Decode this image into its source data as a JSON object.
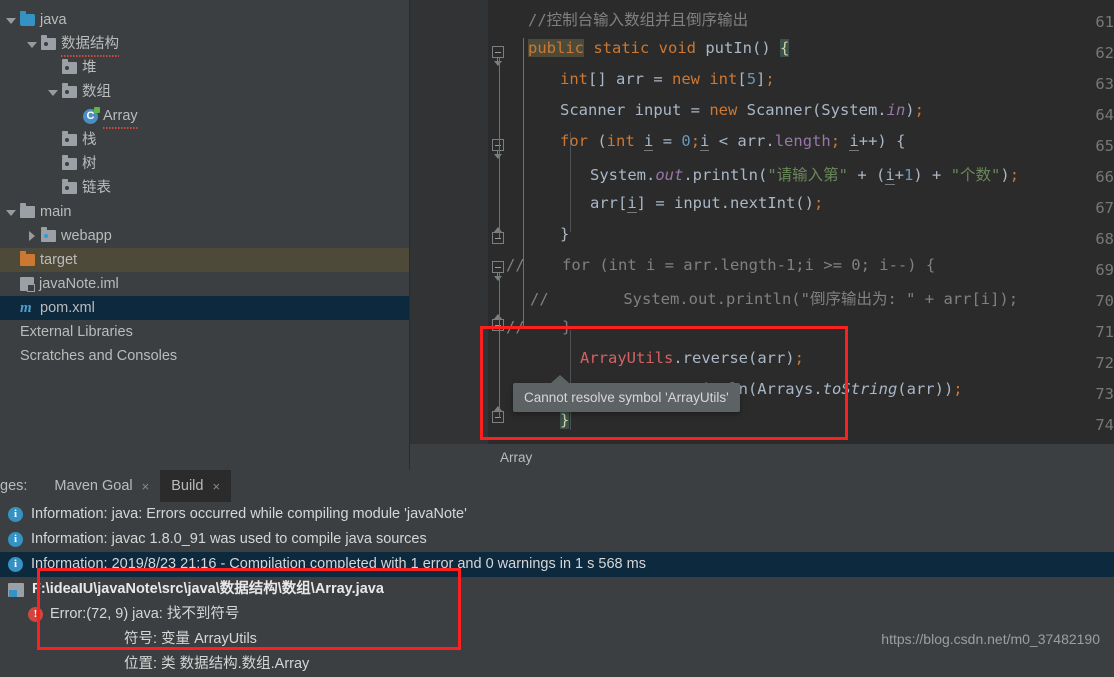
{
  "sidebar": {
    "items": [
      {
        "label": "java",
        "icon": "folder-source-icon",
        "arrow": "down",
        "indent": 0,
        "state": "normal",
        "squiggle": false
      },
      {
        "label": "数据结构",
        "icon": "folder-package-icon",
        "arrow": "down",
        "indent": 1,
        "state": "normal",
        "squiggle": true
      },
      {
        "label": "堆",
        "icon": "folder-package-icon",
        "arrow": "none",
        "indent": 2,
        "state": "normal",
        "squiggle": false
      },
      {
        "label": "数组",
        "icon": "folder-package-icon",
        "arrow": "down",
        "indent": 2,
        "state": "normal",
        "squiggle": false
      },
      {
        "label": "Array",
        "icon": "java-class-icon",
        "arrow": "none",
        "indent": 3,
        "state": "normal",
        "squiggle": true
      },
      {
        "label": "栈",
        "icon": "folder-package-icon",
        "arrow": "none",
        "indent": 2,
        "state": "normal",
        "squiggle": false
      },
      {
        "label": "树",
        "icon": "folder-package-icon",
        "arrow": "none",
        "indent": 2,
        "state": "normal",
        "squiggle": false
      },
      {
        "label": "链表",
        "icon": "folder-package-icon",
        "arrow": "none",
        "indent": 2,
        "state": "normal",
        "squiggle": false
      },
      {
        "label": "main",
        "icon": "folder-gray-icon",
        "arrow": "down",
        "indent": 0,
        "state": "normal",
        "squiggle": false
      },
      {
        "label": "webapp",
        "icon": "folder-webapp-icon",
        "arrow": "right",
        "indent": 1,
        "state": "normal",
        "squiggle": false
      },
      {
        "label": "target",
        "icon": "folder-excluded-icon",
        "arrow": "none",
        "indent": 0,
        "state": "highlight-olive",
        "squiggle": false
      },
      {
        "label": "javaNote.iml",
        "icon": "module-iml-icon",
        "arrow": "none",
        "indent": 0,
        "state": "normal",
        "squiggle": false
      },
      {
        "label": "pom.xml",
        "icon": "maven-icon",
        "arrow": "none",
        "indent": 0,
        "state": "selected-blue",
        "squiggle": false
      },
      {
        "label": "External Libraries",
        "icon": "none",
        "arrow": "none",
        "indent": 0,
        "state": "normal",
        "squiggle": false
      },
      {
        "label": "Scratches and Consoles",
        "icon": "none",
        "arrow": "none",
        "indent": 0,
        "state": "normal",
        "squiggle": false
      }
    ]
  },
  "editor": {
    "breadcrumb": "Array",
    "line_numbers": [
      "61",
      "62",
      "63",
      "64",
      "65",
      "66",
      "67",
      "68",
      "69",
      "70",
      "71",
      "72",
      "73",
      "74"
    ],
    "lines": [
      {
        "n": "61",
        "text": "//控制台输入数组并且倒序输出"
      },
      {
        "n": "62",
        "text": "public static void putIn() {"
      },
      {
        "n": "63",
        "text": "int[] arr = new int[5];"
      },
      {
        "n": "64",
        "text": "Scanner input = new Scanner(System.in);"
      },
      {
        "n": "65",
        "text": "for (int i = 0;i < arr.length; i++) {"
      },
      {
        "n": "66",
        "text": "System.out.println(\"请输入第\" + (i+1) + \"个数\");"
      },
      {
        "n": "67",
        "text": "arr[i] = input.nextInt();"
      },
      {
        "n": "68",
        "text": "}"
      },
      {
        "n": "69",
        "text": "//    for (int i = arr.length-1;i >= 0; i--) {"
      },
      {
        "n": "70",
        "text": "//        System.out.println(\"倒序输出为: \" + arr[i]);"
      },
      {
        "n": "71",
        "text": "//    }"
      },
      {
        "n": "72",
        "text": "ArrayUtils.reverse(arr);"
      },
      {
        "n": "73",
        "text": "System.out.println(Arrays.toString(arr));"
      },
      {
        "n": "74",
        "text": "}"
      }
    ],
    "tooltip": "Cannot resolve symbol 'ArrayUtils'"
  },
  "bottom": {
    "messages_label": "ges:",
    "tabs": [
      {
        "label": "Maven Goal",
        "active": false,
        "close": "×"
      },
      {
        "label": "Build",
        "active": true,
        "close": "×"
      }
    ],
    "rows": [
      {
        "type": "info",
        "text": "Information: java: Errors occurred while compiling module 'javaNote'",
        "selected": false
      },
      {
        "type": "info",
        "text": "Information: javac 1.8.0_91 was used to compile java sources",
        "selected": false
      },
      {
        "type": "info",
        "text": "Information: 2019/8/23 21:16 - Compilation completed with 1 error and 0 warnings in 1 s 568 ms",
        "selected": true
      },
      {
        "type": "file",
        "text": "F:\\ideaIU\\javaNote\\src\\java\\数据结构\\数组\\Array.java",
        "selected": false
      },
      {
        "type": "error",
        "text": "Error:(72, 9)  java: 找不到符号",
        "selected": false
      },
      {
        "type": "plain",
        "text": "符号:  变量 ArrayUtils",
        "selected": false
      },
      {
        "type": "plain",
        "text": "位置: 类 数据结构.数组.Array",
        "selected": false
      }
    ]
  },
  "watermark": "https://blog.csdn.net/m0_37482190",
  "colors": {
    "accent_blue": "#3592c4",
    "error_red": "#d0473f",
    "annotation_red": "#fc2020",
    "editor_bg": "#2b2b2b",
    "panel_bg": "#3c3f41",
    "selection_blue": "#0d293e",
    "highlight_olive": "#4e4a3a"
  }
}
